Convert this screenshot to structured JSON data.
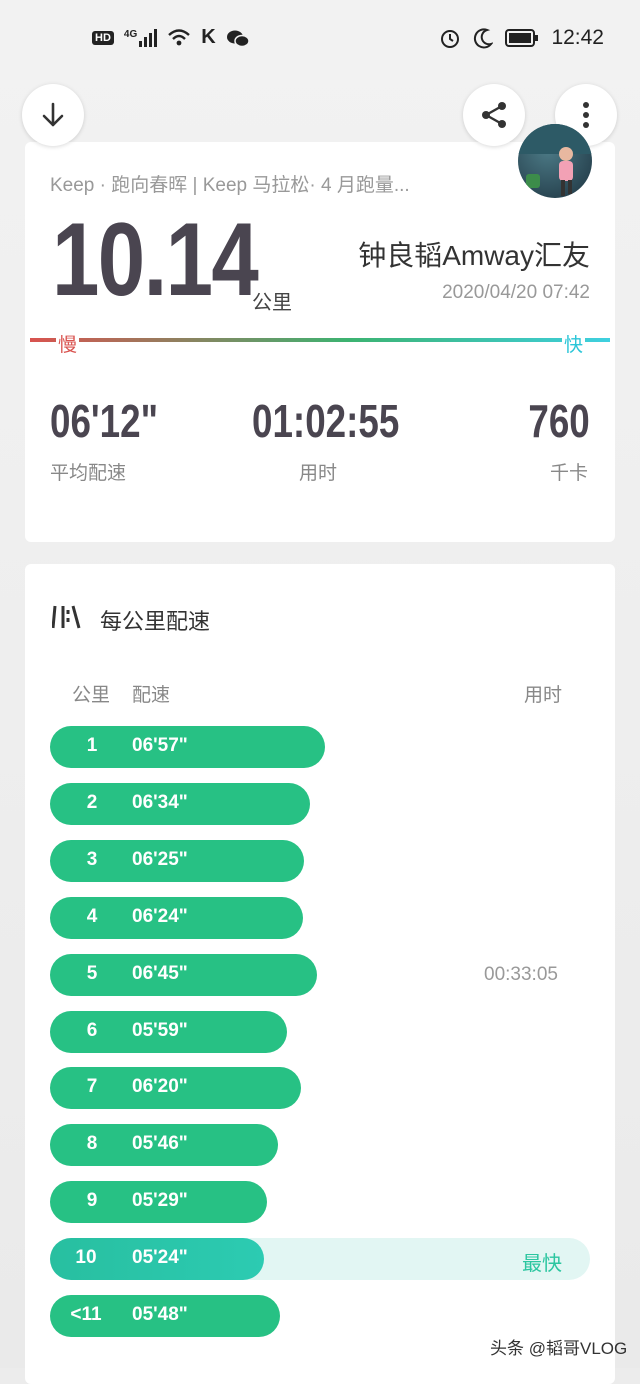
{
  "status_bar": {
    "left_badge": "HD",
    "network": "4G",
    "carrier_mark": "K",
    "time": "12:42"
  },
  "header": {
    "subtitle": "Keep · 跑向春晖 | Keep 马拉松· 4 月跑量...",
    "distance": "10.14",
    "distance_unit": "公里",
    "user_name": "钟良韬Amway汇友",
    "datetime": "2020/04/20 07:42",
    "slow_label": "慢",
    "fast_label": "快"
  },
  "stats": [
    {
      "value": "06'12\"",
      "label": "平均配速"
    },
    {
      "value": "01:02:55",
      "label": "用时"
    },
    {
      "value": "760",
      "label": "千卡"
    }
  ],
  "pace_section": {
    "title": "每公里配速",
    "col_km": "公里",
    "col_pace": "配速",
    "col_time": "用时",
    "fastest_tag": "最快",
    "rows": [
      {
        "km": "1",
        "pace": "06'57\"",
        "seconds": 417
      },
      {
        "km": "2",
        "pace": "06'34\"",
        "seconds": 394
      },
      {
        "km": "3",
        "pace": "06'25\"",
        "seconds": 385
      },
      {
        "km": "4",
        "pace": "06'24\"",
        "seconds": 384
      },
      {
        "km": "5",
        "pace": "06'45\"",
        "seconds": 405,
        "time": "00:33:05"
      },
      {
        "km": "6",
        "pace": "05'59\"",
        "seconds": 359
      },
      {
        "km": "7",
        "pace": "06'20\"",
        "seconds": 380
      },
      {
        "km": "8",
        "pace": "05'46\"",
        "seconds": 346
      },
      {
        "km": "9",
        "pace": "05'29\"",
        "seconds": 329
      },
      {
        "km": "10",
        "pace": "05'24\"",
        "seconds": 324,
        "fastest": true
      },
      {
        "km": "<11",
        "pace": "05'48\"",
        "seconds": 348
      }
    ]
  },
  "watermark": "头条 @韬哥VLOG",
  "colors": {
    "bar": "#27c184",
    "fastest_track": "#e2f6f3",
    "slow": "#d9534f",
    "fast": "#3fd0e0"
  }
}
